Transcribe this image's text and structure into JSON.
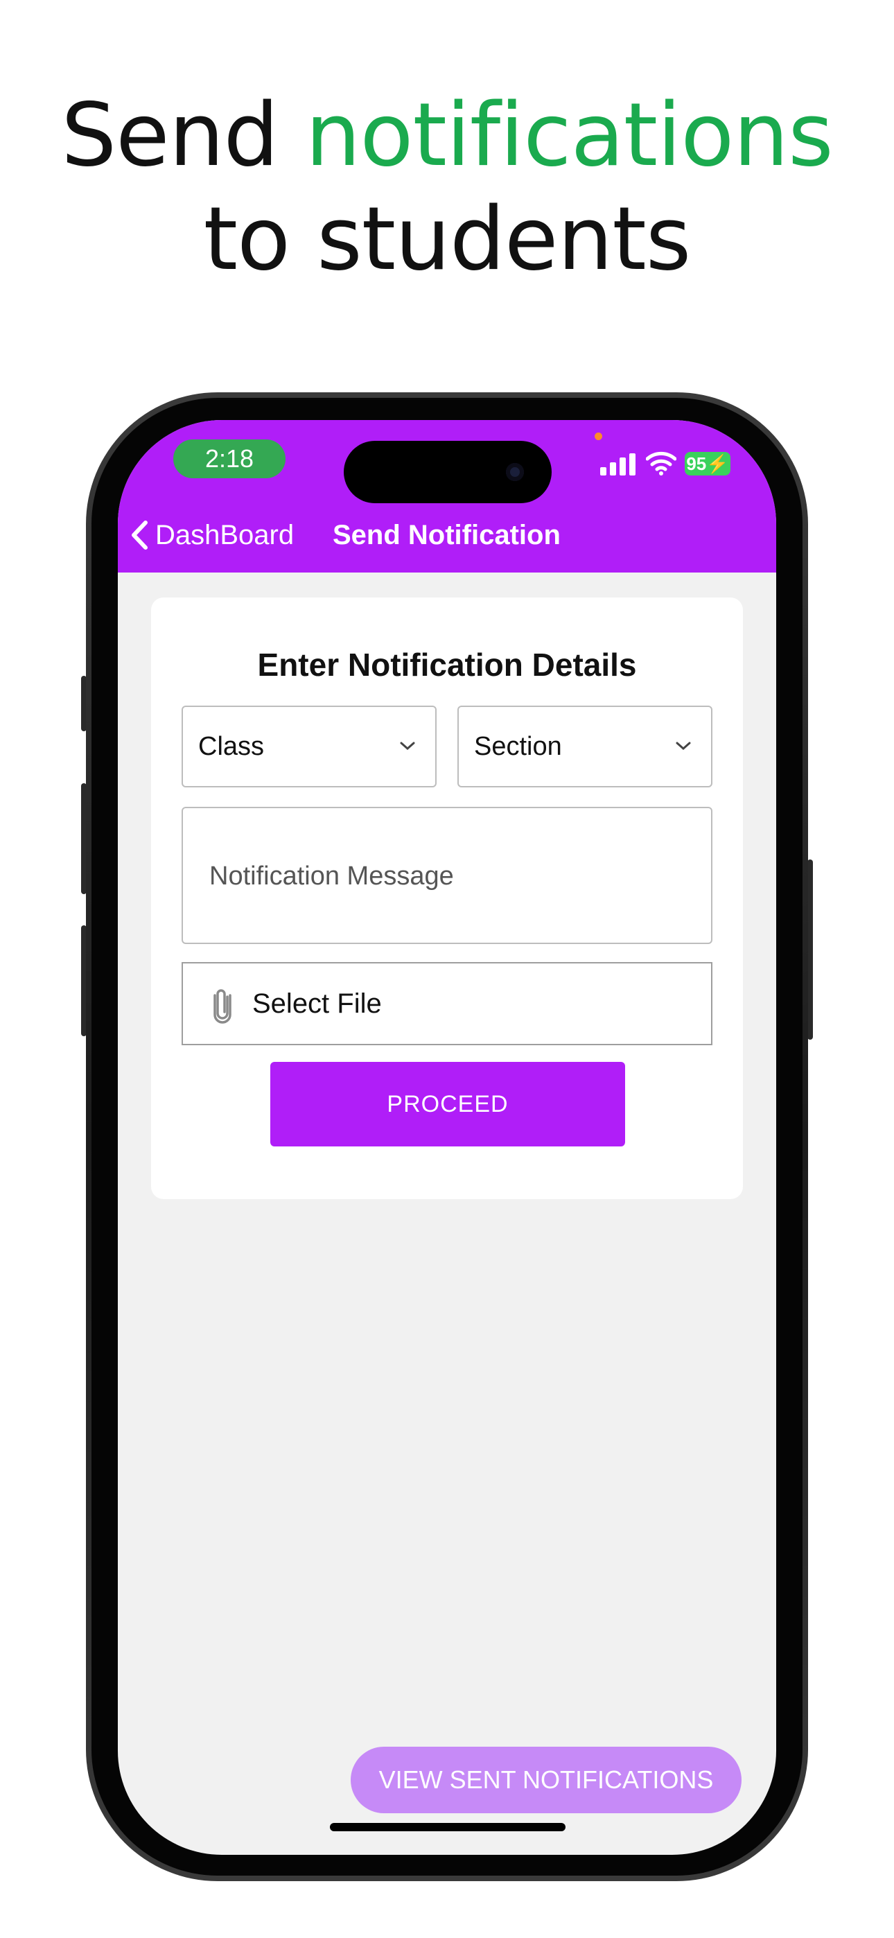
{
  "headline": {
    "part1": "Send ",
    "accent": "notifications",
    "line2": "to students",
    "accent_color": "#1aaa4e"
  },
  "status_bar": {
    "time": "2:18",
    "battery": "95",
    "icons": [
      "cellular-signal-icon",
      "wifi-icon",
      "battery-charging-icon"
    ]
  },
  "nav": {
    "back_label": "DashBoard",
    "title": "Send Notification",
    "color": "#b01ef8"
  },
  "form": {
    "title": "Enter Notification Details",
    "class_select": {
      "value": "Class"
    },
    "section_select": {
      "value": "Section"
    },
    "message_placeholder": "Notification Message",
    "file_label": "Select File",
    "proceed_label": "PROCEED"
  },
  "footer": {
    "view_sent_label": "VIEW SENT NOTIFICATIONS"
  }
}
